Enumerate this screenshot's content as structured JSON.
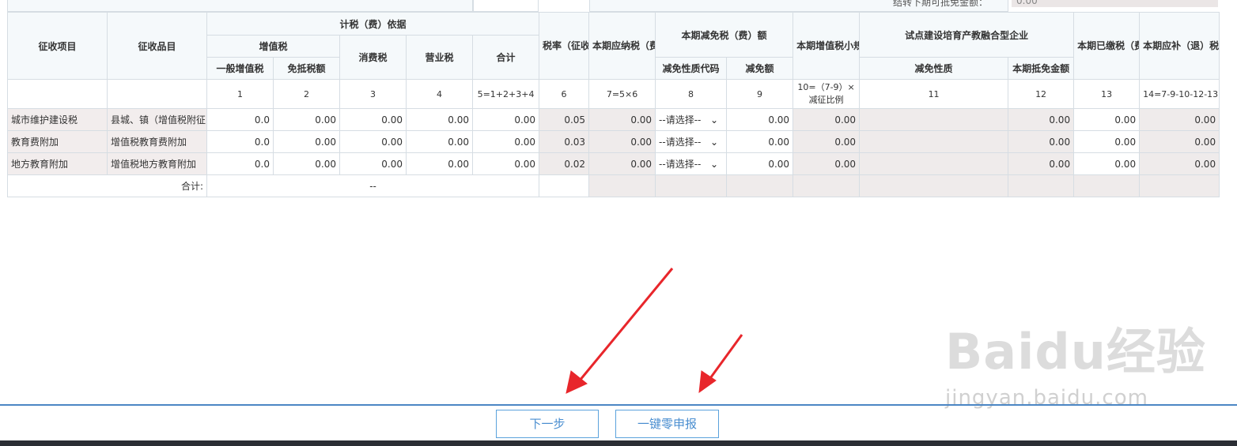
{
  "top": {
    "carry_label": "结转下期可抵免金额：",
    "carry_value": "0.00"
  },
  "headers": {
    "item": "征收项目",
    "subitem": "征收品目",
    "basis": "计税（费）依据",
    "vat": "增值税",
    "general_vat": "一般增值税",
    "exempt_offset": "免抵税额",
    "consumption": "消费税",
    "business": "营业税",
    "subtotal": "合计",
    "rate": "税率（征收率）",
    "payable": "本期应纳税（费）额",
    "reduction": "本期减免税（费）额",
    "reduction_code": "减免性质代码",
    "reduction_amount": "减免额",
    "small_scale": "本期增值税小规模纳税人减征额",
    "pilot": "试点建设培育产教融合型企业",
    "pilot_nature": "减免性质",
    "pilot_offset": "本期抵免金额",
    "paid": "本期已缴税（费）额",
    "refund": "本期应补（退）税（费）额"
  },
  "numbers": [
    "1",
    "2",
    "3",
    "4",
    "5=1+2+3+4",
    "6",
    "7=5×6",
    "8",
    "9",
    "10=（7-9）×减征比例",
    "11",
    "12",
    "13",
    "14=7-9-10-12-13"
  ],
  "rows": [
    {
      "item": "城市维护建设税",
      "subitem": "县城、镇（增值税附征",
      "general": "0.0",
      "exempt": "0.00",
      "consumption": "0.00",
      "business": "0.00",
      "subtotal": "0.00",
      "rate": "0.05",
      "payable": "0.00",
      "code": "--请选择--",
      "reduction": "0.00",
      "small": "0.00",
      "pilot_nature": "",
      "pilot_offset": "0.00",
      "paid": "0.00",
      "refund": "0.00"
    },
    {
      "item": "教育费附加",
      "subitem": "增值税教育费附加",
      "general": "0.0",
      "exempt": "0.00",
      "consumption": "0.00",
      "business": "0.00",
      "subtotal": "0.00",
      "rate": "0.03",
      "payable": "0.00",
      "code": "--请选择--",
      "reduction": "0.00",
      "small": "0.00",
      "pilot_nature": "",
      "pilot_offset": "0.00",
      "paid": "0.00",
      "refund": "0.00"
    },
    {
      "item": "地方教育附加",
      "subitem": "增值税地方教育附加",
      "general": "0.0",
      "exempt": "0.00",
      "consumption": "0.00",
      "business": "0.00",
      "subtotal": "0.00",
      "rate": "0.02",
      "payable": "0.00",
      "code": "--请选择--",
      "reduction": "0.00",
      "small": "0.00",
      "pilot_nature": "",
      "pilot_offset": "0.00",
      "paid": "0.00",
      "refund": "0.00"
    }
  ],
  "total": {
    "label": "合计:",
    "value": "--"
  },
  "buttons": {
    "next": "下一步",
    "zero_declare": "一键零申报"
  },
  "watermark": {
    "brand": "Baidu经验",
    "url": "jingyan.baidu.com"
  },
  "colors": {
    "arrow": "#e8262b",
    "button_border": "#5ba2dc",
    "divider": "#4b86c4"
  },
  "icons": {
    "dropdown": "chevron-down-icon",
    "arrow": "red-arrow-icon"
  }
}
